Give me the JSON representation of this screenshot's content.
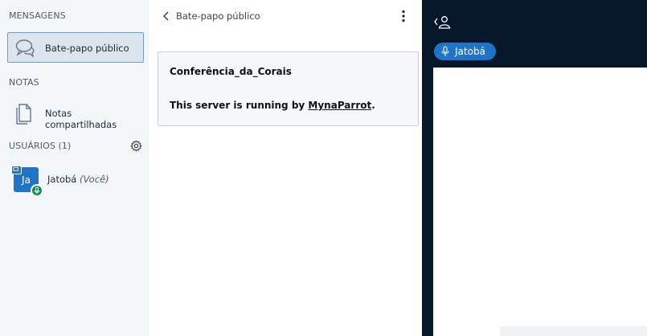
{
  "sidebar": {
    "messages_title": "MENSAGENS",
    "public_chat_label": "Bate-papo público",
    "notes_title": "NOTAS",
    "shared_notes_label": "Notas compartilhadas",
    "users_title": "USUÁRIOS (1)",
    "user": {
      "initials": "Ja",
      "name": "Jatobá",
      "you_tag": "(Você)"
    }
  },
  "chat": {
    "title": "Bate-papo público",
    "welcome_conference": "Conferência_da_Corais",
    "welcome_prefix": "This server is running by ",
    "welcome_link": "MynaParrot",
    "welcome_suffix": "."
  },
  "stage": {
    "talking_user": "Jatobá"
  },
  "colors": {
    "accent": "#1f74c7",
    "mic_green": "#0e8a56",
    "stage_bg": "#06172a",
    "sidebar_bg": "#f3f6f9"
  }
}
